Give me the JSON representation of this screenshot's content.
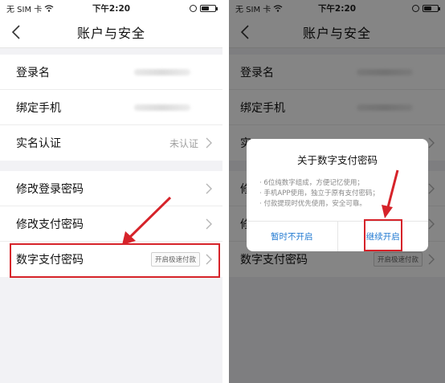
{
  "status": {
    "carrier": "无 SIM 卡",
    "time": "下午2:20",
    "battery_level": 0.55
  },
  "nav": {
    "title": "账户与安全",
    "back_icon": "chevron-left-icon"
  },
  "account": {
    "login_name_label": "登录名",
    "phone_label": "绑定手机",
    "realname_label": "实名认证",
    "realname_value": "未认证"
  },
  "security": {
    "change_login_pwd_label": "修改登录密码",
    "change_pay_pwd_label": "修改支付密码",
    "digital_pay_pwd_label": "数字支付密码",
    "fast_pay_badge": "开启极速付款"
  },
  "right_partial": {
    "realname_label_partial": "实",
    "change_login_partial": "修",
    "change_pay_partial": "修"
  },
  "dialog": {
    "title": "关于数字支付密码",
    "lines": [
      "· 6位纯数字组成，方便记忆使用；",
      "· 手机APP使用，独立于原有支付密码；",
      "· 付款提现时优先使用，安全可靠。"
    ],
    "cancel_label": "暂时不开启",
    "confirm_label": "继续开启"
  },
  "colors": {
    "highlight": "#d6232a",
    "link_blue": "#1f78d1",
    "background": "#f2f2f5"
  }
}
